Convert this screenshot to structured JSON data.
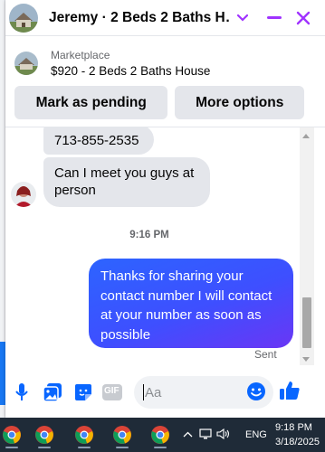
{
  "colors": {
    "accent": "#0866ff",
    "title_close": "#a033ff",
    "bubble_in": "#e4e6eb",
    "bubble_out_start": "#2d64ff",
    "bubble_out_end": "#6a36f5",
    "taskbar": "#1f2b38"
  },
  "header": {
    "title": "Jeremy · 2 Beds 2 Baths House",
    "title_truncated": "Jeremy · 2 Beds 2 Baths H…",
    "icons": [
      "chevron-down-icon",
      "minimize-icon",
      "close-icon"
    ]
  },
  "listing": {
    "label": "Marketplace",
    "title": "$920 - 2 Beds 2 Baths House"
  },
  "actions": {
    "pending_label": "Mark as pending",
    "more_label": "More options"
  },
  "messages": [
    {
      "direction": "incoming",
      "text": "713-855-2535"
    },
    {
      "direction": "incoming",
      "text": "Can I meet you guys at person"
    },
    {
      "direction": "outgoing",
      "text": "Thanks for sharing your contact number I will contact at your number as soon as possible"
    }
  ],
  "timestamp": "9:16 PM",
  "status": "Sent",
  "composer": {
    "placeholder": "Aa",
    "icons": [
      "microphone-icon",
      "photo-icon",
      "sticker-icon",
      "gif-icon",
      "emoji-icon",
      "thumbs-up-icon"
    ],
    "gif_label": "GIF"
  },
  "taskbar": {
    "apps": [
      "chrome-icon",
      "chrome-icon",
      "chrome-icon",
      "chrome-icon",
      "chrome-icon",
      "chrome-icon"
    ],
    "tray_icons": [
      "chevron-up-icon",
      "network-icon",
      "volume-icon"
    ],
    "language": "ENG",
    "time": "9:18 PM",
    "date": "3/18/2025"
  }
}
